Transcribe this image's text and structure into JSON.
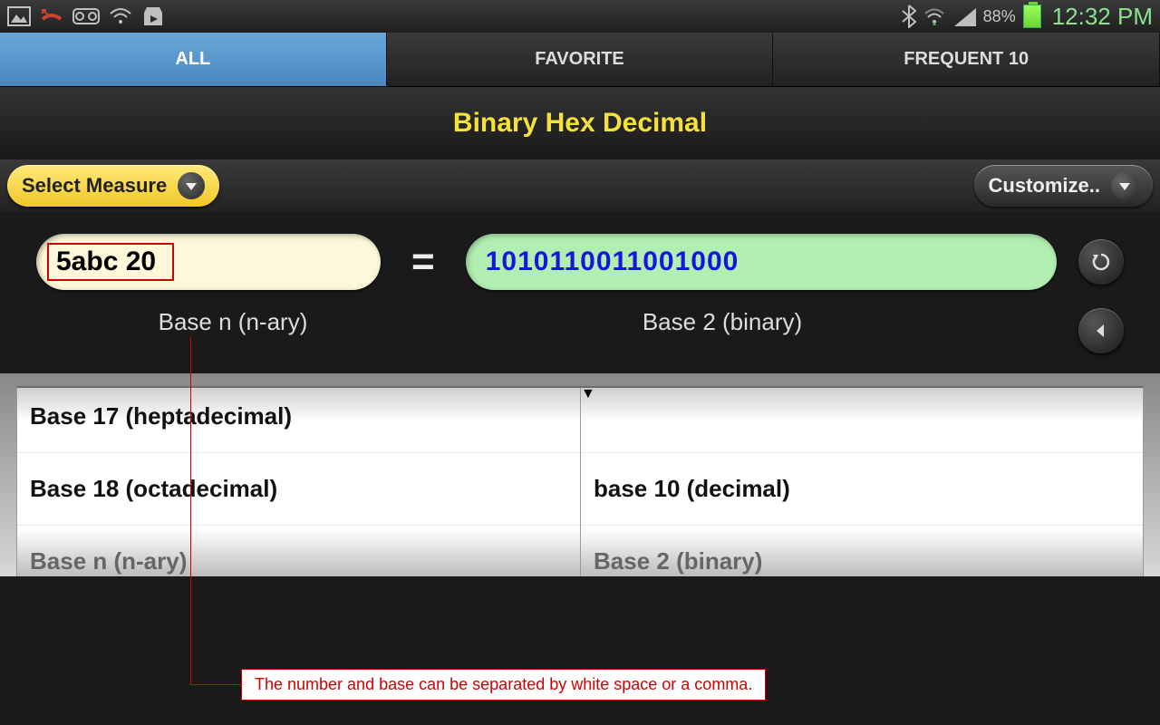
{
  "status": {
    "battery_pct": "88%",
    "time": "12:32 PM"
  },
  "tabs": {
    "all": "ALL",
    "favorite": "FAVORITE",
    "frequent": "FREQUENT 10"
  },
  "title": "Binary Hex Decimal",
  "buttons": {
    "select_measure": "Select Measure",
    "customize": "Customize.."
  },
  "conversion": {
    "input_value": "5abc  20",
    "equals": "=",
    "output_value": "1010110011001000",
    "input_label": "Base n (n-ary)",
    "output_label": "Base 2 (binary)"
  },
  "picker_left": {
    "item0": "Base 17 (heptadecimal)",
    "item1": "Base 18 (octadecimal)",
    "item2": "Base n (n-ary)"
  },
  "picker_right": {
    "item0": "",
    "item1": "base 10 (decimal)",
    "item2": "Base 2 (binary)"
  },
  "callout": "The number and base can be separated by white space or a comma."
}
